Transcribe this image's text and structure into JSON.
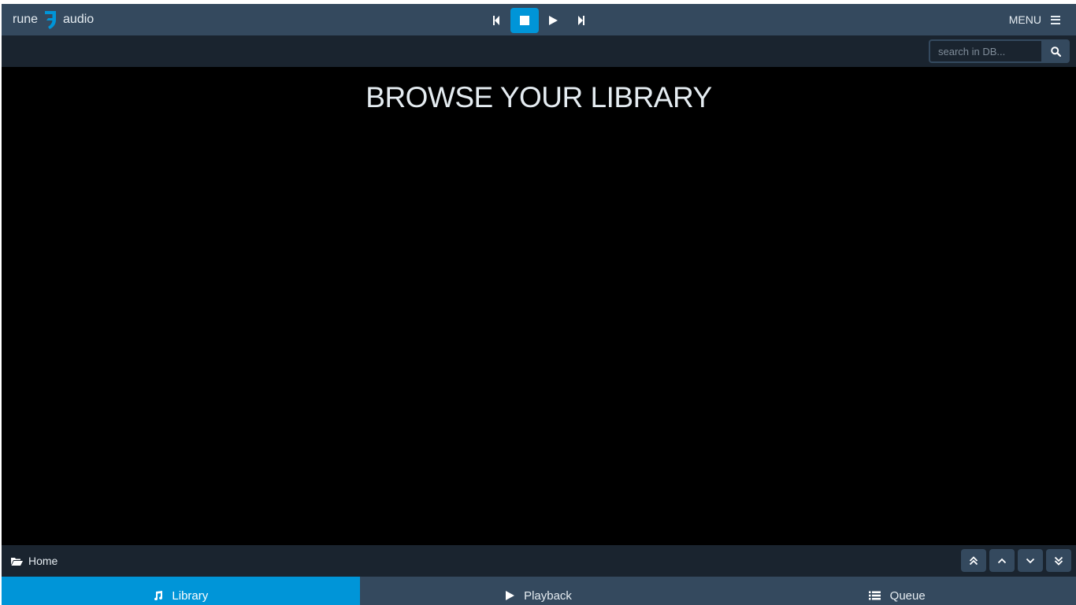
{
  "brand": {
    "left_text": "rune",
    "right_text": "audio",
    "icon": "rune-logo-icon"
  },
  "transport": {
    "previous": "previous-icon",
    "stop": "stop-icon",
    "play": "play-icon",
    "next": "next-icon",
    "active": "stop"
  },
  "menu": {
    "label": "MENU",
    "icon": "hamburger-icon"
  },
  "search": {
    "placeholder": "search in DB...",
    "value": "",
    "icon": "search-icon"
  },
  "main": {
    "heading": "BROWSE YOUR LIBRARY"
  },
  "breadcrumb": {
    "label": "Home",
    "icon": "folder-open-icon"
  },
  "scroll_buttons": [
    "scroll-top-icon",
    "scroll-up-icon",
    "scroll-down-icon",
    "scroll-bottom-icon"
  ],
  "tabs": [
    {
      "label": "Library",
      "icon": "music-note-icon",
      "active": true
    },
    {
      "label": "Playback",
      "icon": "play-icon",
      "active": false
    },
    {
      "label": "Queue",
      "icon": "list-icon",
      "active": false
    }
  ],
  "colors": {
    "accent": "#0095d8",
    "bar": "#34495e",
    "dark_bar": "#1a242f",
    "background": "#000000"
  }
}
